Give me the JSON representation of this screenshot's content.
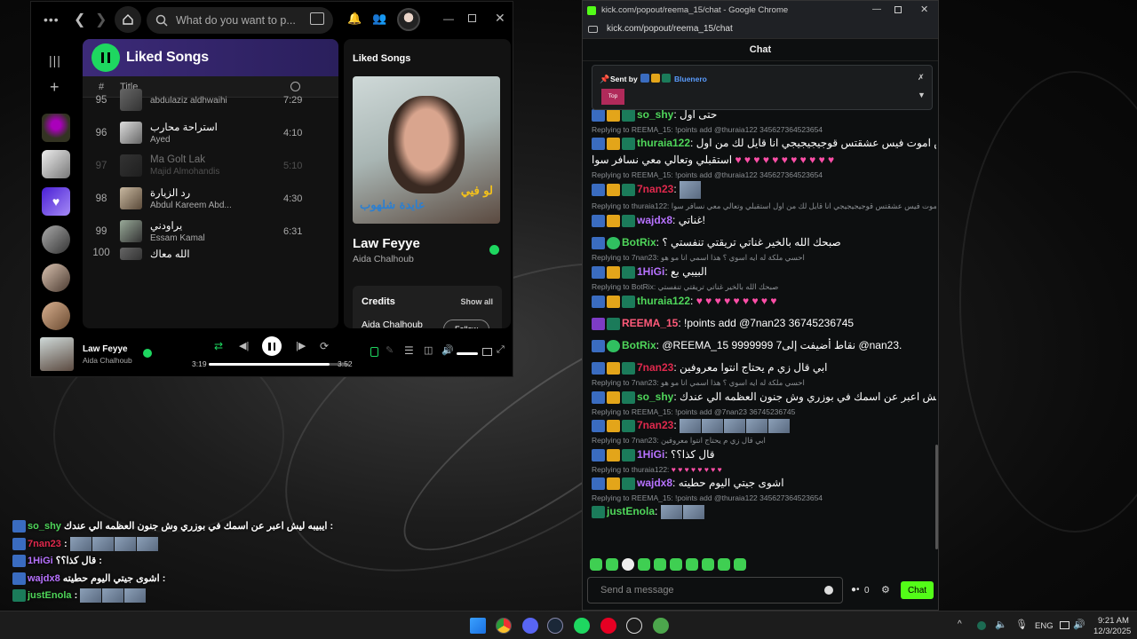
{
  "spotify": {
    "search_placeholder": "What do you want to p...",
    "playlist_title": "Liked Songs",
    "col_number": "#",
    "col_title": "Title",
    "tracks": [
      {
        "num": "95",
        "title": "",
        "artist": "abdulaziz aldhwaihi",
        "duration": "7:29"
      },
      {
        "num": "96",
        "title": "استراحة محارب",
        "artist": "Ayed",
        "duration": "4:10"
      },
      {
        "num": "97",
        "title": "Ma Golt Lak",
        "artist": "Majid Almohandis",
        "duration": "5:10"
      },
      {
        "num": "98",
        "title": "رد الزيارة",
        "artist": "Abdul Kareem Abd...",
        "duration": "4:30"
      },
      {
        "num": "99",
        "title": "يراودني",
        "artist": "Essam Kamal",
        "duration": "6:31"
      },
      {
        "num": "100",
        "title": "الله معاك",
        "artist": "",
        "duration": ""
      }
    ],
    "panel_title": "Liked Songs",
    "album_text_1": "لو فيي",
    "album_text_2": "عايدة شلهوب",
    "song_title": "Law Feyye",
    "song_artist": "Aida Chalhoub",
    "credits_label": "Credits",
    "show_all": "Show all",
    "credit_name": "Aida Chalhoub",
    "follow_label": "Follow",
    "player_title": "Law Feyye",
    "player_artist": "Aida Chalhoub",
    "time_elapsed": "3:19",
    "time_total": "3:52",
    "progress": 0.86
  },
  "chrome": {
    "title": "kick.com/popout/reema_15/chat - Google Chrome",
    "url": "kick.com/popout/reema_15/chat"
  },
  "chat": {
    "header": "Chat",
    "pinned_sent_by": "Sent by",
    "pinned_user": "Bluenero",
    "pinned_tag": "Top",
    "send_placeholder": "Send a message",
    "viewer_count": "0",
    "chat_button": "Chat",
    "messages": [
      {
        "reply": "",
        "badges": [
          "mod",
          "crown",
          "sub"
        ],
        "user": "so_shy",
        "color": "#4fd65a",
        "text": "حتى اول"
      },
      {
        "reply": "Replying to REEMA_15: !points add @thuraia122 345627364523654",
        "badges": [
          "mod",
          "crown",
          "sub"
        ],
        "user": "thuraia122",
        "color": "#4fd65a",
        "text": "احبس اموت فيس عشقتس قوجيجيجيجي انا قايل لك من اول"
      },
      {
        "reply": "",
        "badges": [],
        "user": "",
        "color": "#fff",
        "text": "استقبلي وتعالي معي نسافر سوا"
      },
      {
        "reply": "Replying to REEMA_15: !points add @thuraia122 345627364523654",
        "badges": [
          "mod",
          "crown",
          "sub"
        ],
        "user": "7nan23",
        "color": "#e0294d",
        "text": ""
      },
      {
        "reply": "Replying to thuraia122: احبس اموت فيس عشقتس قوجيجيجيجي انا قايل لك من اول استقبلي وتعالي معي نسافر سوا ...",
        "badges": [
          "mod",
          "crown",
          "sub"
        ],
        "user": "wajdx8",
        "color": "#b772ff",
        "text": "غناتي!"
      },
      {
        "reply": "",
        "badges": [
          "mod",
          "ver"
        ],
        "user": "BotRix",
        "color": "#4fd65a",
        "text": "صبحك الله بالخير  غناتي تريقتي تنفستي ؟"
      },
      {
        "reply": "Replying to 7nan23: احسي ملكة له ايه اسوي ؟ هذا اسمي انا مو هو",
        "badges": [
          "mod",
          "crown",
          "sub"
        ],
        "user": "1HiGi",
        "color": "#b772ff",
        "text": "البيبي بع"
      },
      {
        "reply": "Replying to BotRix: صبحك الله بالخير غناتي تريقتي تنفستي",
        "badges": [
          "mod",
          "crown",
          "sub"
        ],
        "user": "thuraia122",
        "color": "#4fd65a",
        "text": ""
      },
      {
        "reply": "",
        "badges": [
          "mic",
          "sub"
        ],
        "user": "REEMA_15",
        "color": "#ff5a7a",
        "text": "!points add @7nan23 36745236745"
      },
      {
        "reply": "",
        "badges": [
          "mod",
          "ver"
        ],
        "user": "BotRix",
        "color": "#4fd65a",
        "text": "@REEMA_15 9999999 7نقاط أضيفت إلى @nan23."
      },
      {
        "reply": "",
        "badges": [
          "mod",
          "crown",
          "sub"
        ],
        "user": "7nan23",
        "color": "#e0294d",
        "text": "ابي قال زي م يحتاج انتوا معروفين"
      },
      {
        "reply": "Replying to 7nan23: احسي ملكة له ايه اسوي ؟ هذا اسمي انا مو هو",
        "badges": [
          "mod",
          "crown",
          "sub"
        ],
        "user": "so_shy",
        "color": "#4fd65a",
        "text": "ايبيبه ليش اعبر عن اسمك في بوزري وش جنون العظمه الي عندك"
      },
      {
        "reply": "Replying to REEMA_15: !points add @7nan23 36745236745",
        "badges": [
          "mod",
          "crown",
          "sub"
        ],
        "user": "7nan23",
        "color": "#e0294d",
        "text": ""
      },
      {
        "reply": "Replying to 7nan23: ابي قال زي م يحتاج انتوا معروفين",
        "badges": [
          "mod",
          "crown",
          "sub"
        ],
        "user": "1HiGi",
        "color": "#b772ff",
        "text": "قال كذا؟؟"
      },
      {
        "reply": "Replying to thuraia122:",
        "badges": [
          "mod",
          "crown",
          "sub"
        ],
        "user": "wajdx8",
        "color": "#b772ff",
        "text": "اشوى جيتي اليوم حطيته"
      },
      {
        "reply": "Replying to REEMA_15: !points add @thuraia122 345627364523654",
        "badges": [
          "sub"
        ],
        "user": "justEnola",
        "color": "#4fd65a",
        "text": ""
      }
    ]
  },
  "overlay": [
    {
      "user": "so_shy",
      "color": "#4fd65a",
      "text": "ايبيبه ليش اعبر عن اسمك في بوزري وش جنون العظمه الي عندك :"
    },
    {
      "user": "7nan23",
      "color": "#e0294d",
      "text": ":"
    },
    {
      "user": "1HiGi",
      "color": "#b772ff",
      "text": "قال كذا؟؟ :"
    },
    {
      "user": "wajdx8",
      "color": "#b772ff",
      "text": "اشوى جيتي اليوم حطيته :"
    },
    {
      "user": "justEnola",
      "color": "#4fd65a",
      "text": ":"
    }
  ],
  "taskbar": {
    "lang": "ENG",
    "time": "9:21 AM",
    "date": "12/3/2025"
  }
}
